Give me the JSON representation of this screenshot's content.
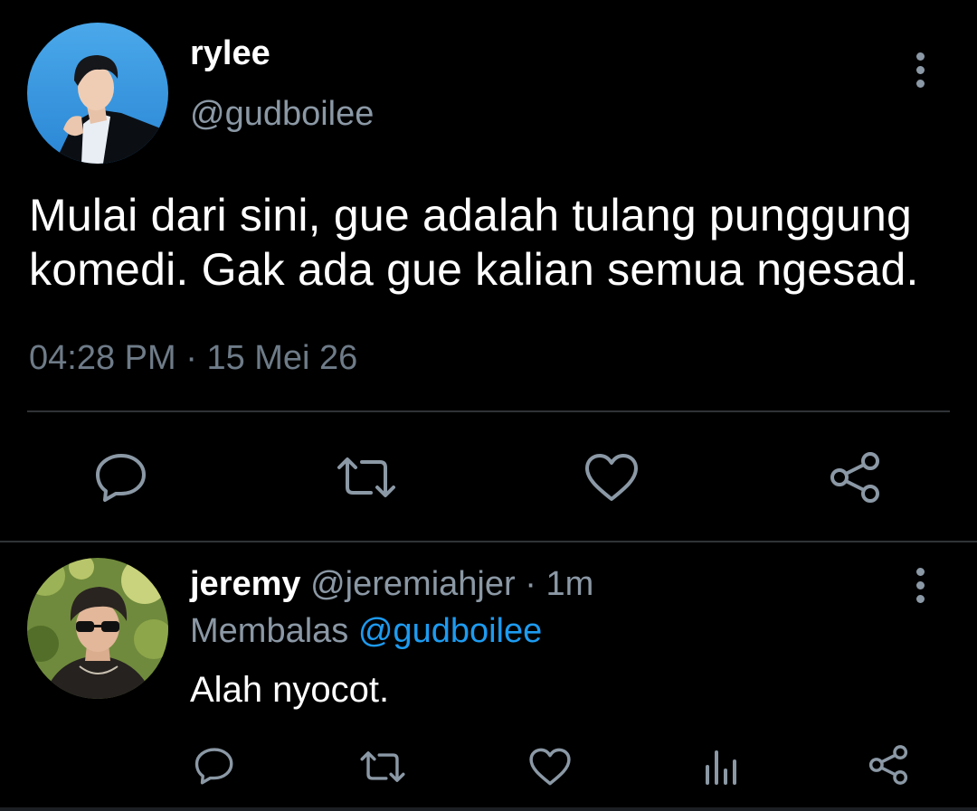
{
  "main_tweet": {
    "author_name": "rylee",
    "author_handle": "@gudboilee",
    "text": "Mulai dari sini, gue adalah tulang punggung komedi. Gak ada gue kalian semua ngesad.",
    "time": "04:28 PM",
    "date_separator": " · ",
    "date": "15 Mei 26",
    "actions": [
      "reply-icon",
      "retweet-icon",
      "like-icon",
      "share-icon"
    ]
  },
  "reply": {
    "author_name": "jeremy",
    "author_handle": "@jeremiahjer",
    "time_separator": " · ",
    "relative_time": "1m",
    "replying_label": "Membalas",
    "replying_to": "@gudboilee",
    "text": "Alah nyocot.",
    "actions": [
      "reply-icon",
      "retweet-icon",
      "like-icon",
      "analytics-icon",
      "share-icon"
    ]
  },
  "colors": {
    "background": "#000000",
    "primary_text": "#ffffff",
    "secondary_text": "#8b98a5",
    "meta_text": "#6e7b88",
    "accent": "#1d9bf0",
    "divider": "#2f3336"
  }
}
